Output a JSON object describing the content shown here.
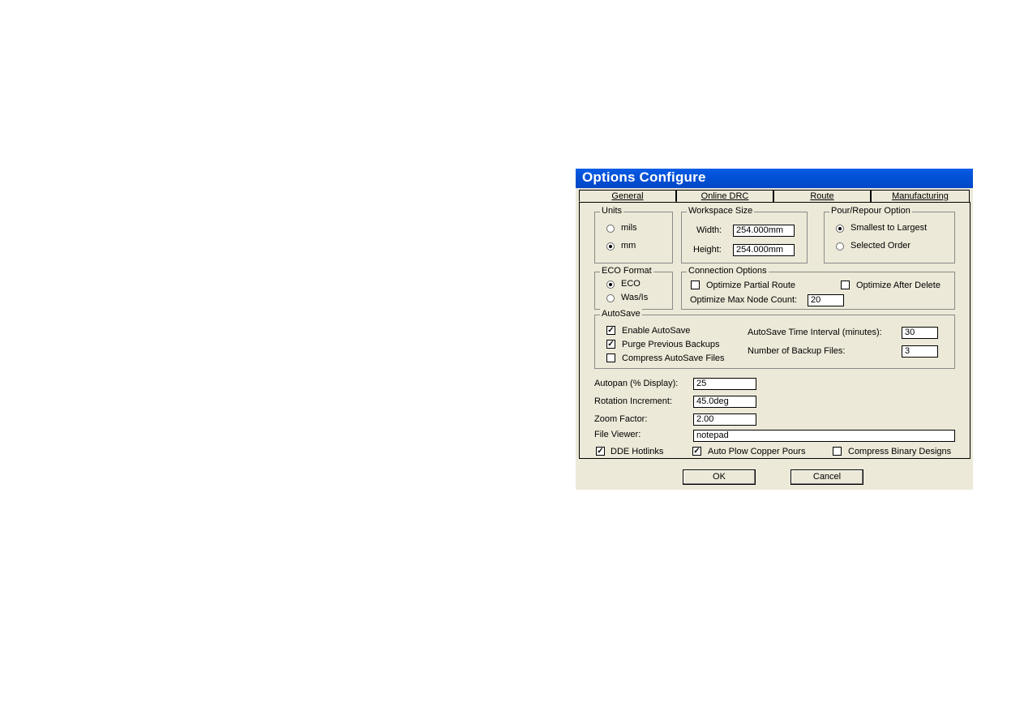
{
  "dialog": {
    "title": "Options Configure"
  },
  "tabs": [
    {
      "label": "General",
      "active": true
    },
    {
      "label": "Online DRC",
      "active": false
    },
    {
      "label": "Route",
      "active": false
    },
    {
      "label": "Manufacturing",
      "active": false
    }
  ],
  "units": {
    "legend": "Units",
    "options": [
      {
        "label": "mils",
        "selected": false
      },
      {
        "label": "mm",
        "selected": true
      }
    ]
  },
  "workspace": {
    "legend": "Workspace Size",
    "width_label": "Width:",
    "width_value": "254.000mm",
    "height_label": "Height:",
    "height_value": "254.000mm"
  },
  "pour": {
    "legend": "Pour/Repour Option",
    "options": [
      {
        "label": "Smallest to Largest",
        "selected": true
      },
      {
        "label": "Selected Order",
        "selected": false
      }
    ]
  },
  "eco": {
    "legend": "ECO Format",
    "options": [
      {
        "label": "ECO",
        "selected": true
      },
      {
        "label": "Was/Is",
        "selected": false
      }
    ]
  },
  "connection": {
    "legend": "Connection Options",
    "optimize_partial": {
      "label": "Optimize Partial Route",
      "checked": false
    },
    "optimize_after_delete": {
      "label": "Optimize After Delete",
      "checked": false
    },
    "max_node_label": "Optimize Max Node Count:",
    "max_node_value": "20"
  },
  "autosave": {
    "legend": "AutoSave",
    "enable": {
      "label": "Enable AutoSave",
      "checked": true
    },
    "purge": {
      "label": "Purge Previous Backups",
      "checked": true
    },
    "compress": {
      "label": "Compress AutoSave Files",
      "checked": false
    },
    "interval_label": "AutoSave Time Interval (minutes):",
    "interval_value": "30",
    "backups_label": "Number of Backup Files:",
    "backups_value": "3"
  },
  "fields": {
    "autopan_label": "Autopan (% Display):",
    "autopan_value": "25",
    "rotation_label": "Rotation Increment:",
    "rotation_value": "45.0deg",
    "zoom_label": "Zoom Factor:",
    "zoom_value": "2.00",
    "viewer_label": "File Viewer:",
    "viewer_value": "notepad"
  },
  "bottom_checks": {
    "dde": {
      "label": "DDE Hotlinks",
      "checked": true
    },
    "autoplow": {
      "label": "Auto Plow Copper Pours",
      "checked": true
    },
    "compress_binary": {
      "label": "Compress Binary Designs",
      "checked": false
    }
  },
  "buttons": {
    "ok": "OK",
    "cancel": "Cancel"
  },
  "colors": {
    "titlebar": "#0251d6",
    "dialog_bg": "#ece9d8"
  },
  "check_glyph": "✓"
}
